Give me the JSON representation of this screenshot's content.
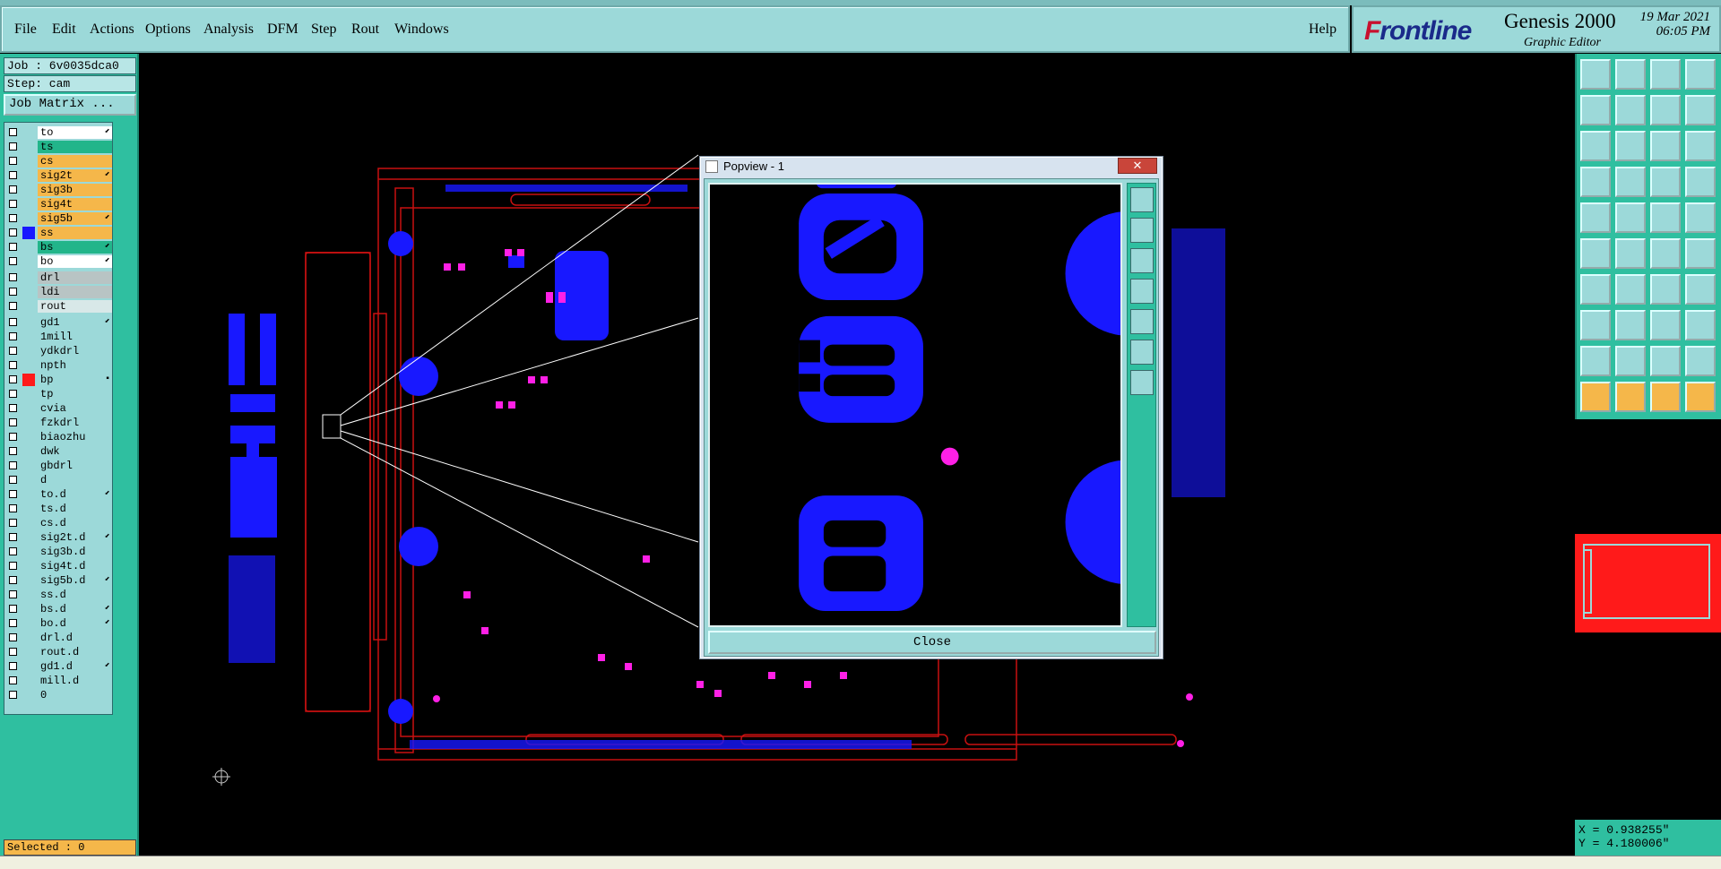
{
  "menu": [
    "File",
    "Edit",
    "Actions",
    "Options",
    "Analysis",
    "DFM",
    "Step",
    "Rout",
    "Windows"
  ],
  "help": "Help",
  "brand": {
    "logo_prefix": "F",
    "logo_rest": "rontline",
    "product": "Genesis 2000",
    "subtitle": "Graphic Editor",
    "date": "19 Mar 2021",
    "time": "06:05 PM"
  },
  "job": "Job : 6v0035dca0",
  "step": "Step: cam",
  "job_matrix": "Job Matrix ...",
  "selected": "Selected : 0",
  "popview": {
    "title": "Popview - 1",
    "close": "Close",
    "close_x": "✕"
  },
  "coords": {
    "x": "X = 0.938255\"",
    "y": "Y = 4.180006\""
  },
  "colors": {
    "teal": "#9cd9d9",
    "panel": "#2fbfa0",
    "orange": "#f5b74a",
    "green": "#22b58a",
    "blue": "#1818ff",
    "magenta": "#ff20e6",
    "outline": "#c81010"
  },
  "layers": [
    {
      "name": "to",
      "bg": "#ffffff",
      "sw": "",
      "mark": "⬋"
    },
    {
      "name": "ts",
      "bg": "#22b58a",
      "sw": "",
      "mark": ""
    },
    {
      "name": "cs",
      "bg": "#f5b74a",
      "sw": "",
      "mark": ""
    },
    {
      "name": "sig2t",
      "bg": "#f5b74a",
      "sw": "",
      "mark": "⬋"
    },
    {
      "name": "sig3b",
      "bg": "#f5b74a",
      "sw": "",
      "mark": ""
    },
    {
      "name": "sig4t",
      "bg": "#f5b74a",
      "sw": "",
      "mark": ""
    },
    {
      "name": "sig5b",
      "bg": "#f5b74a",
      "sw": "",
      "mark": "⬋"
    },
    {
      "name": "ss",
      "bg": "#f5b74a",
      "sw": "#1818ff",
      "mark": ""
    },
    {
      "name": "bs",
      "bg": "#22b58a",
      "sw": "",
      "mark": "⬋"
    },
    {
      "name": "bo",
      "bg": "#ffffff",
      "sw": "",
      "mark": "⬋"
    },
    {
      "name": "drl",
      "bg": "#b8c4c4",
      "sw": "",
      "mark": ""
    },
    {
      "name": "ldi",
      "bg": "#b8c4c4",
      "sw": "",
      "mark": ""
    },
    {
      "name": "rout",
      "bg": "#d8e8e8",
      "sw": "",
      "mark": ""
    },
    {
      "name": "gd1",
      "bg": "#9cd9d9",
      "sw": "",
      "mark": "⬋"
    },
    {
      "name": "1mill",
      "bg": "#9cd9d9",
      "sw": "",
      "mark": ""
    },
    {
      "name": "ydkdrl",
      "bg": "#9cd9d9",
      "sw": "",
      "mark": ""
    },
    {
      "name": "npth",
      "bg": "#9cd9d9",
      "sw": "",
      "mark": ""
    },
    {
      "name": "bp",
      "bg": "#9cd9d9",
      "sw": "#ff1a1a",
      "mark": "▪"
    },
    {
      "name": "tp",
      "bg": "#9cd9d9",
      "sw": "",
      "mark": ""
    },
    {
      "name": "cvia",
      "bg": "#9cd9d9",
      "sw": "",
      "mark": ""
    },
    {
      "name": "fzkdrl",
      "bg": "#9cd9d9",
      "sw": "",
      "mark": ""
    },
    {
      "name": "biaozhu",
      "bg": "#9cd9d9",
      "sw": "",
      "mark": ""
    },
    {
      "name": "dwk",
      "bg": "#9cd9d9",
      "sw": "",
      "mark": ""
    },
    {
      "name": "gbdrl",
      "bg": "#9cd9d9",
      "sw": "",
      "mark": ""
    },
    {
      "name": "d",
      "bg": "#9cd9d9",
      "sw": "",
      "mark": ""
    },
    {
      "name": "to.d",
      "bg": "#9cd9d9",
      "sw": "",
      "mark": "⬋"
    },
    {
      "name": "ts.d",
      "bg": "#9cd9d9",
      "sw": "",
      "mark": ""
    },
    {
      "name": "cs.d",
      "bg": "#9cd9d9",
      "sw": "",
      "mark": ""
    },
    {
      "name": "sig2t.d",
      "bg": "#9cd9d9",
      "sw": "",
      "mark": "⬋"
    },
    {
      "name": "sig3b.d",
      "bg": "#9cd9d9",
      "sw": "",
      "mark": ""
    },
    {
      "name": "sig4t.d",
      "bg": "#9cd9d9",
      "sw": "",
      "mark": ""
    },
    {
      "name": "sig5b.d",
      "bg": "#9cd9d9",
      "sw": "",
      "mark": "⬋"
    },
    {
      "name": "ss.d",
      "bg": "#9cd9d9",
      "sw": "",
      "mark": ""
    },
    {
      "name": "bs.d",
      "bg": "#9cd9d9",
      "sw": "",
      "mark": "⬋"
    },
    {
      "name": "bo.d",
      "bg": "#9cd9d9",
      "sw": "",
      "mark": "⬋"
    },
    {
      "name": "drl.d",
      "bg": "#9cd9d9",
      "sw": "",
      "mark": ""
    },
    {
      "name": "rout.d",
      "bg": "#9cd9d9",
      "sw": "",
      "mark": ""
    },
    {
      "name": "gd1.d",
      "bg": "#9cd9d9",
      "sw": "",
      "mark": "⬋"
    },
    {
      "name": "mill.d",
      "bg": "#9cd9d9",
      "sw": "",
      "mark": ""
    },
    {
      "name": "0",
      "bg": "#9cd9d9",
      "sw": "",
      "mark": ""
    }
  ],
  "popview_text": {
    "line1": "03",
    "line2": "B"
  },
  "tools": [
    "zoom-in-icon",
    "zoom-out-icon",
    "home-icon",
    "fit-icon",
    "pan-left-icon",
    "pan-right-icon",
    "redraw-icon",
    "undo-icon",
    "zoom-fit-icon",
    "center-icon",
    "scale-icon",
    "help-icon",
    "measure-icon",
    "grid-icon",
    "layers-icon",
    "layers2-icon",
    "snap-icon",
    "line-icon",
    "ruler-icon",
    "pad-icon",
    "connect-icon",
    "cross-icon",
    "node-icon",
    "node2-icon",
    "draw-line-icon",
    "draw-line2-icon",
    "arc-icon",
    "parallel-icon",
    "move-icon",
    "move2-icon",
    "resize-icon",
    "copy-icon",
    "triangle-icon",
    "triangle2-icon",
    "triangle3-icon",
    "triangle4-icon",
    "select-icon",
    "select2-icon",
    "select3-icon",
    "select4-icon"
  ]
}
